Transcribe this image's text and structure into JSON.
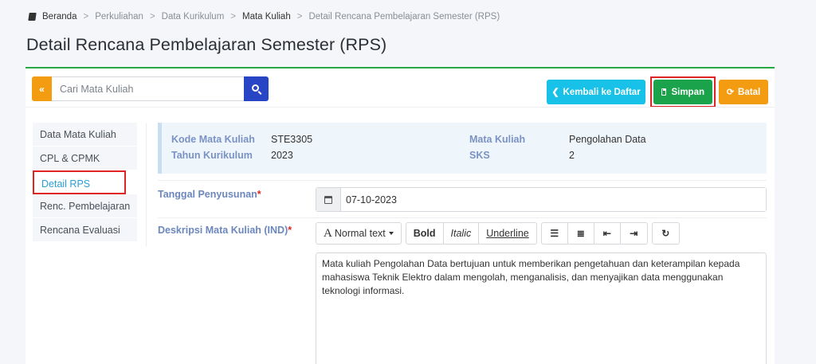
{
  "breadcrumb": {
    "items": [
      "Beranda",
      "Perkuliahan",
      "Data Kurikulum",
      "Mata Kuliah",
      "Detail Rencana Pembelajaran Semester (RPS)"
    ],
    "separator": ">"
  },
  "page_title": "Detail Rencana Pembelajaran Semester (RPS)",
  "toolbar": {
    "search_prefix": "«",
    "search_placeholder": "Cari Mata Kuliah",
    "back_label": "Kembali ke Daftar",
    "save_label": "Simpan",
    "cancel_label": "Batal"
  },
  "sidebar": {
    "items": [
      {
        "label": "Data Mata Kuliah"
      },
      {
        "label": "CPL & CPMK"
      },
      {
        "label": "Detail RPS"
      },
      {
        "label": "Renc. Pembelajaran"
      },
      {
        "label": "Rencana Evaluasi"
      }
    ],
    "active_index": 2
  },
  "info": {
    "kode_label": "Kode Mata Kuliah",
    "kode_value": "STE3305",
    "tahun_label": "Tahun Kurikulum",
    "tahun_value": "2023",
    "mk_label": "Mata Kuliah",
    "mk_value": "Pengolahan Data",
    "sks_label": "SKS",
    "sks_value": "2"
  },
  "form": {
    "tanggal_label": "Tanggal Penyusunan",
    "tanggal_value": "07-10-2023",
    "deskripsi_label": "Deskripsi Mata Kuliah (IND)",
    "required_mark": "*"
  },
  "editor": {
    "normal_text": "Normal text",
    "normal_glyph": "A",
    "bold": "Bold",
    "italic": "Italic",
    "underline": "Underline",
    "content": "Mata kuliah Pengolahan Data bertujuan untuk memberikan pengetahuan dan keterampilan kepada mahasiswa Teknik Elektro dalam mengolah, menganalisis, dan menyajikan data menggunakan teknologi informasi."
  },
  "colors": {
    "accent_green": "#28a745",
    "save_green": "#1aa34a",
    "orange": "#f39c12",
    "cyan": "#17c1e8",
    "blue": "#2745c4",
    "highlight_red": "#e02424"
  }
}
